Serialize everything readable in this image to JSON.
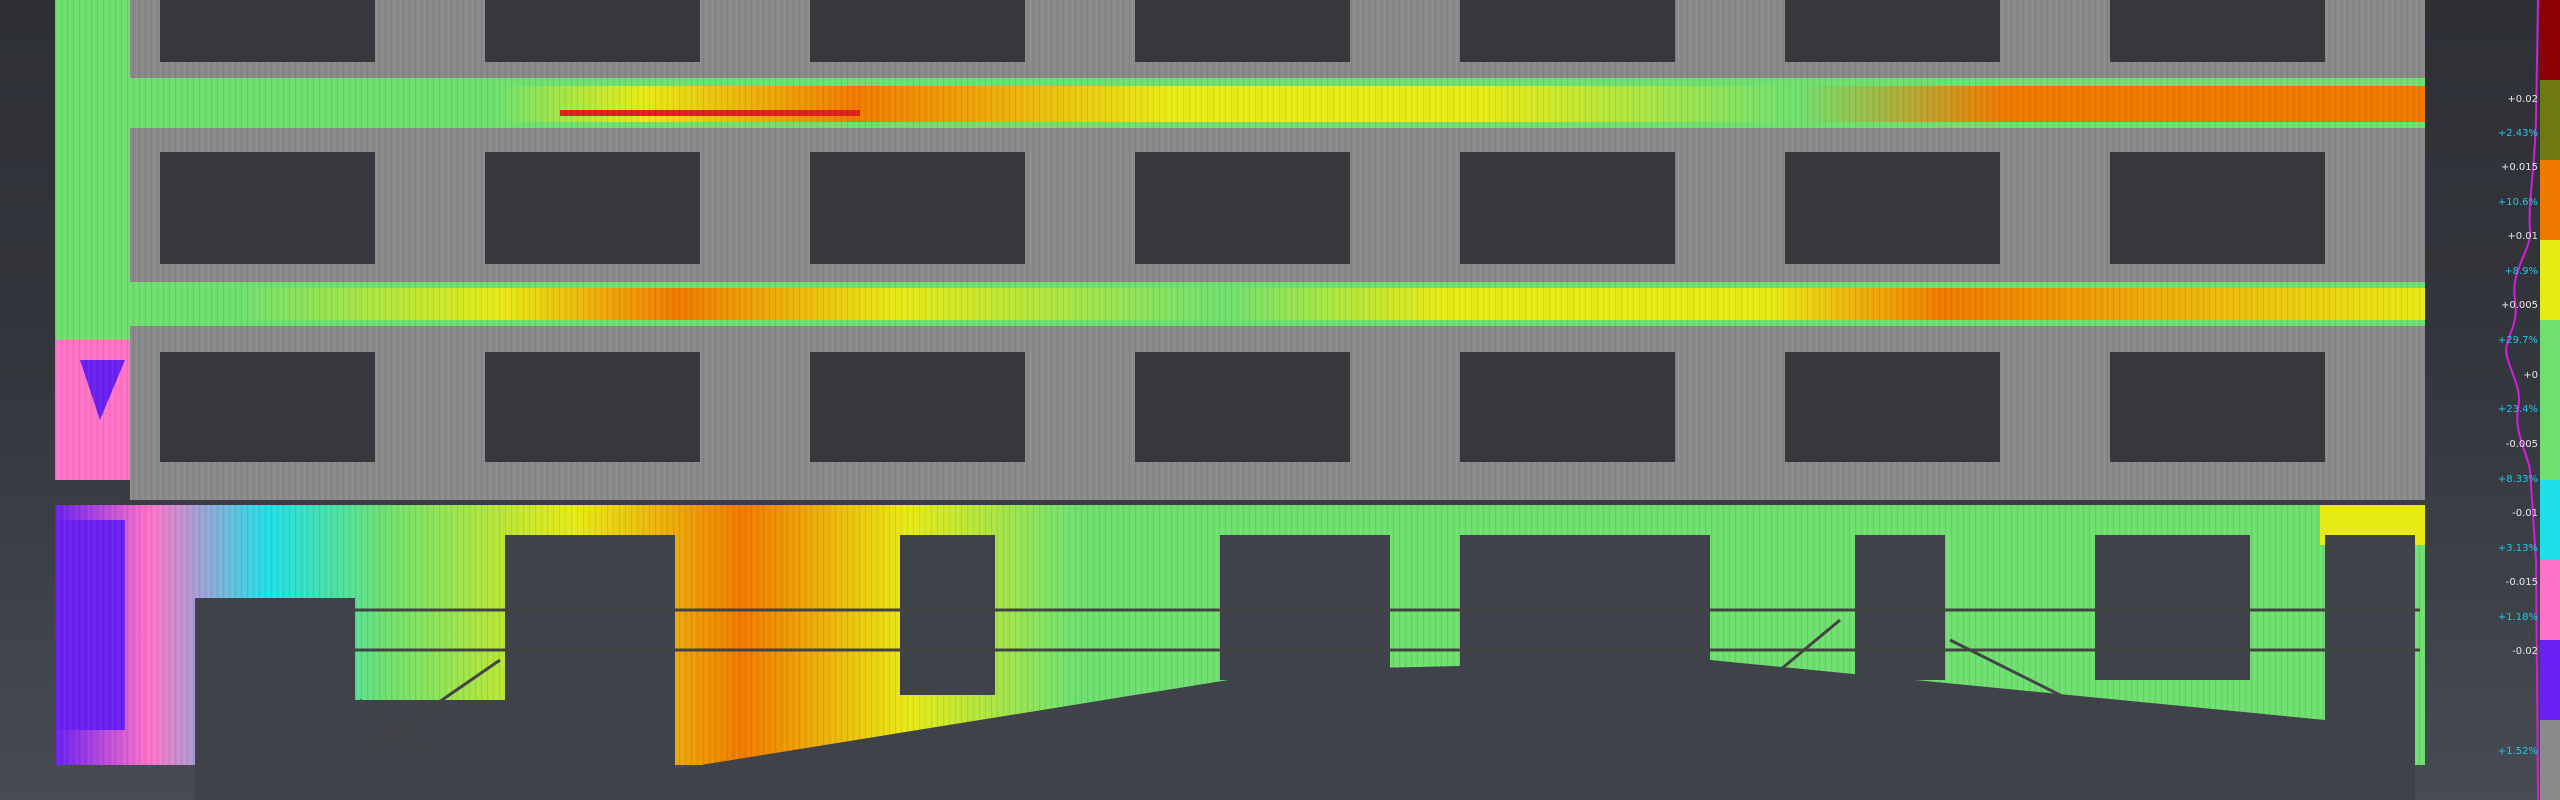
{
  "scale": {
    "labels": [
      "+0.02",
      "+0.015",
      "+0.01",
      "+0.005",
      "+0",
      "-0.005",
      "-0.01",
      "-0.015",
      "-0.02"
    ],
    "percentages": [
      "+2.43%",
      "+10.6%",
      "+8.9%",
      "+29.7%",
      "+23.4%",
      "+8.33%",
      "+3.13%",
      "+1.18%",
      "+1.52%"
    ],
    "bands": [
      "#8b0000",
      "#6d7a12",
      "#f07a00",
      "#e8ea14",
      "#6fe070",
      "#6fe070",
      "#1fe0e8",
      "#ff74c8",
      "#6a20f0",
      "#8a8a8a"
    ]
  },
  "colors": {
    "background": "#33363c",
    "structure_gray": "#8a8a8a",
    "window_dark": "#36383e",
    "green": "#6fe070",
    "yellow": "#e8ea14",
    "orange": "#f07a00",
    "red": "#e02020",
    "cyan": "#1fe0e8",
    "pink": "#ff74c8",
    "blue": "#6a20f0",
    "histogram": "#d020d8"
  }
}
